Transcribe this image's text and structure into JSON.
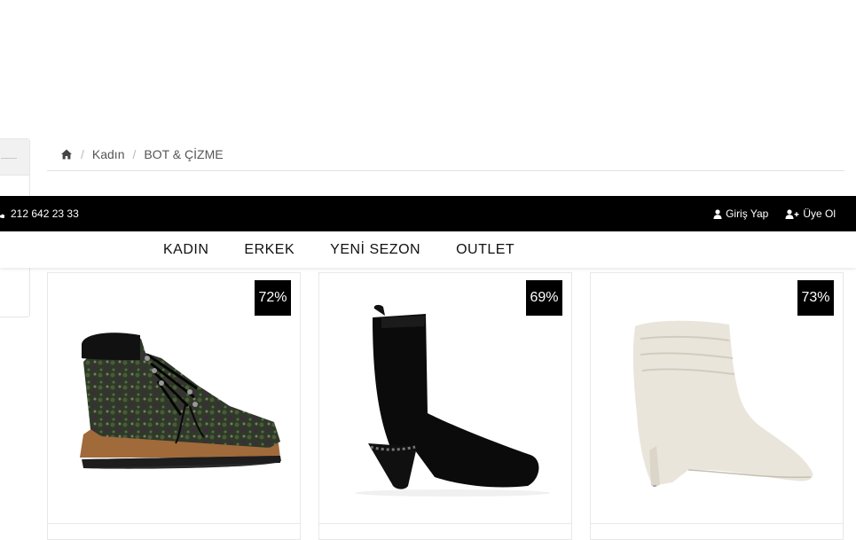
{
  "breadcrumb": {
    "home_icon": "home-icon",
    "items": [
      "Kadın",
      "BOT & ÇİZME"
    ]
  },
  "topbar": {
    "phone": "212 642 23 33",
    "login": "Giriş Yap",
    "register": "Üye Ol"
  },
  "nav": {
    "items": [
      "KADIN",
      "ERKEK",
      "YENİ SEZON",
      "OUTLET"
    ]
  },
  "products": [
    {
      "discount": "72%",
      "image": "green-lace-up-boot"
    },
    {
      "discount": "69%",
      "image": "black-suede-ankle-boot"
    },
    {
      "discount": "73%",
      "image": "white-slouch-stiletto-boot"
    }
  ],
  "colors": {
    "topbar_bg": "#000000",
    "badge_bg": "#000000"
  }
}
